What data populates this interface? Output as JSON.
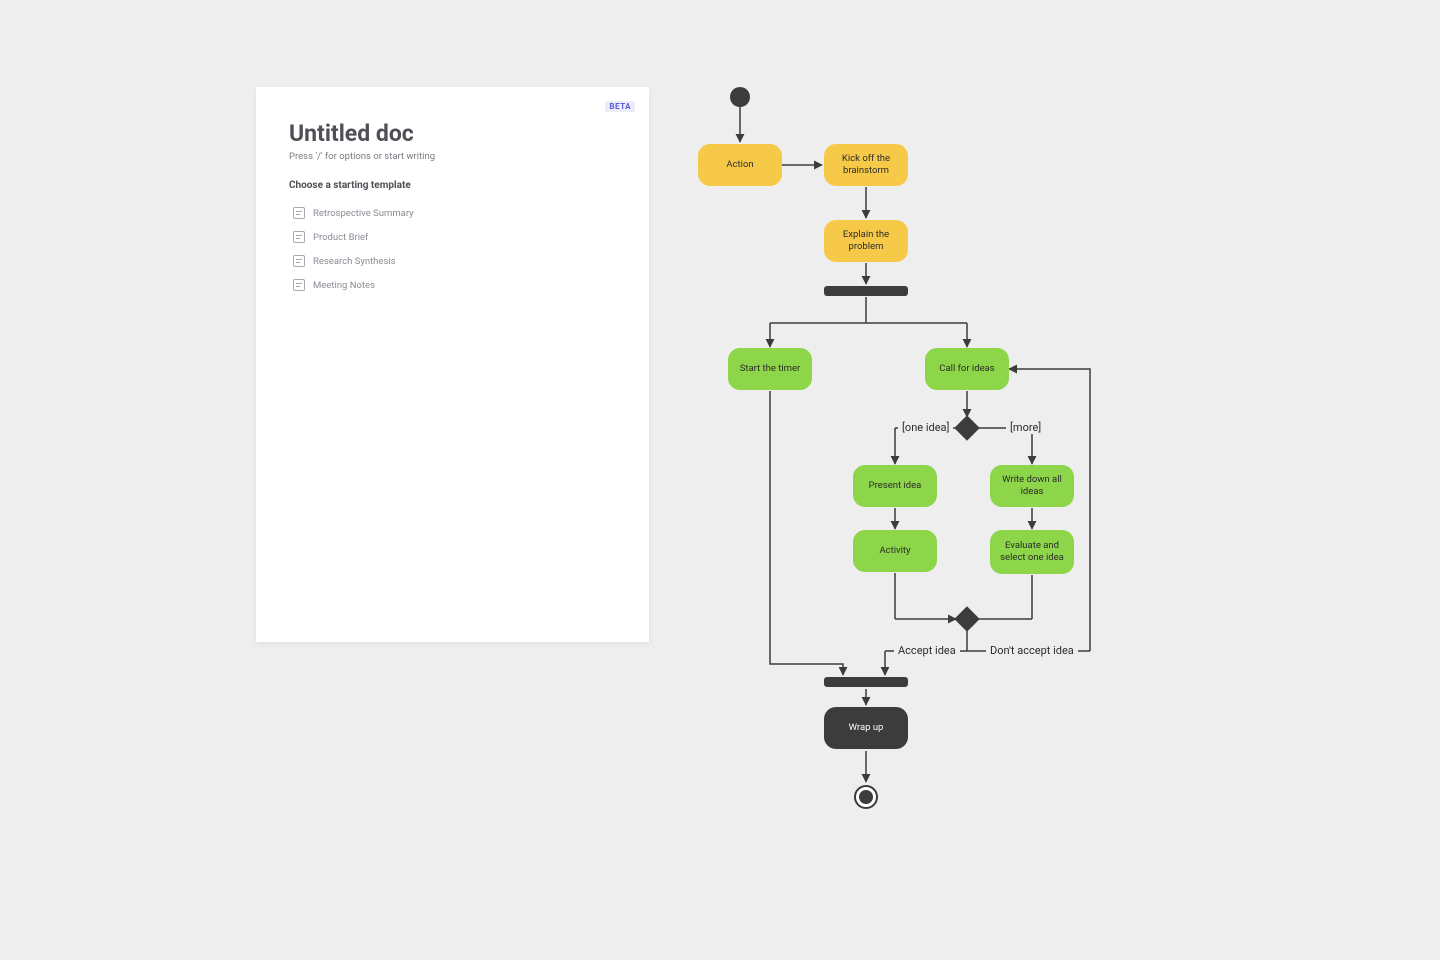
{
  "doc": {
    "beta": "BETA",
    "title": "Untitled doc",
    "subtitle": "Press '/' for options or start writing",
    "section_label": "Choose a starting template",
    "templates": [
      {
        "label": "Retrospective Summary"
      },
      {
        "label": "Product Brief"
      },
      {
        "label": "Research Synthesis"
      },
      {
        "label": "Meeting Notes"
      }
    ]
  },
  "flow": {
    "nodes": {
      "action": "Action",
      "kickoff": "Kick off the brainstorm",
      "explain": "Explain the problem",
      "start_timer": "Start the timer",
      "call_ideas": "Call for ideas",
      "present_idea": "Present idea",
      "writedown": "Write down all ideas",
      "activity": "Activity",
      "evaluate": "Evaluate and select one idea",
      "wrapup": "Wrap up"
    },
    "edge_labels": {
      "one_idea": "[one idea]",
      "more": "[more]",
      "accept": "Accept idea",
      "dont_accept": "Don't accept idea"
    }
  }
}
